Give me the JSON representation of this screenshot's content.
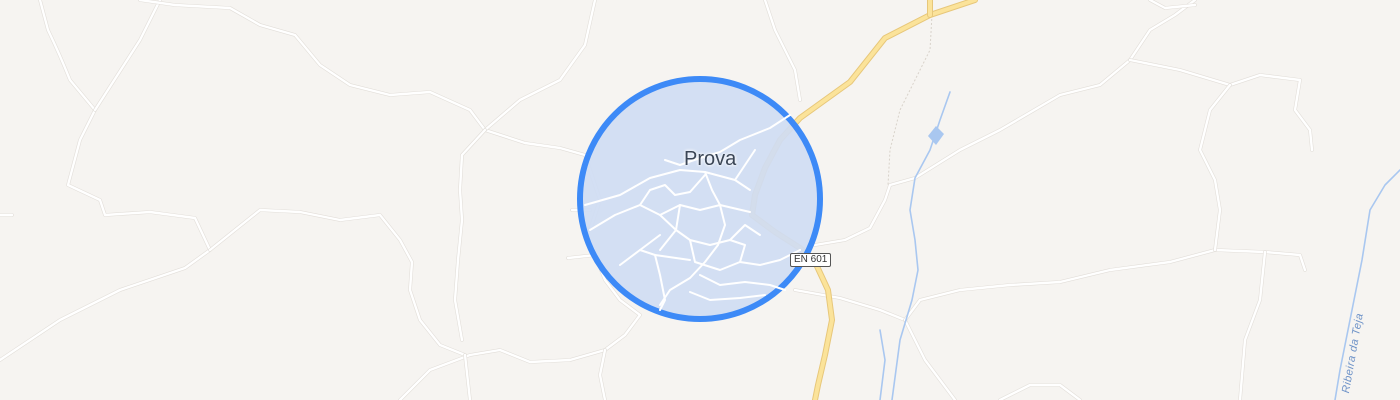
{
  "map": {
    "place_label": "Prova",
    "road_shield": "EN 601",
    "water_label": "Ribeira da Teja",
    "colors": {
      "background": "#f6f4f1",
      "minor_road": "#ffffff",
      "main_road": "#fbe39a",
      "water": "#a9c7f0",
      "highlight_fill": "#cfdcf3",
      "highlight_stroke": "#3d8af7"
    },
    "highlight": "location-radius-circle"
  }
}
